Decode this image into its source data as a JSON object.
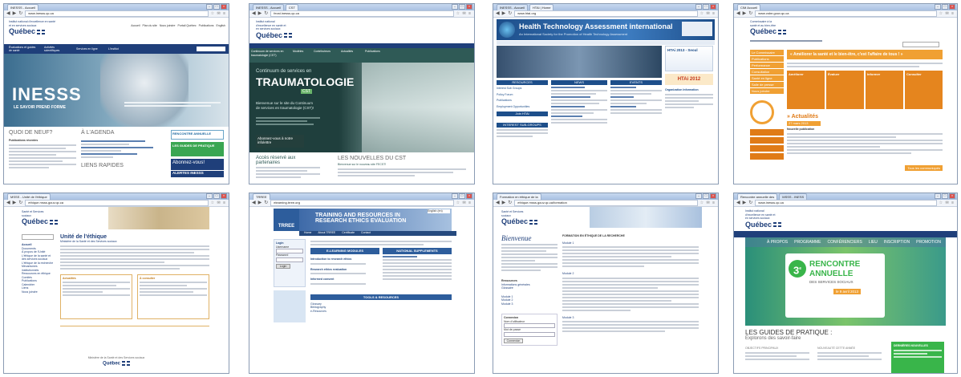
{
  "windows": [
    {
      "tabs": [
        "INESSS - Accueil"
      ],
      "url": "www.inesss.qc.ca",
      "brand": "Institut national d'excellence en santé et en services sociaux",
      "quebec": "Québec",
      "nav": [
        "Accueil",
        "Plan du site",
        "Nous joindre",
        "Portail Québec",
        "Publications",
        "Recherche",
        "English"
      ],
      "menu": [
        "Évaluations et guides de santé",
        "Activités scientifiques",
        "Services en ligne",
        "L'institut"
      ],
      "hero_title": "INESSS",
      "hero_sub": "LE SAVOIR PREND FORME",
      "col1_title": "QUOI DE NEUF?",
      "col2_title": "À L'AGENDA",
      "col1_sub": "Publications récentes",
      "col2_link": "LIENS RAPIDES",
      "promo1": "RENCONTRE ANNUELLE",
      "promo2": "LES GUIDES DE PRATIQUE",
      "promo3": "Abonnez-vous!",
      "promo4": "ALERTES INESSS"
    },
    {
      "tabs": [
        "INESSS - Accueil",
        "CST"
      ],
      "url": "fecst.inesss.qc.ca",
      "quebec": "Québec",
      "hero_small": "Continuum de services en",
      "hero_big": "TRAUMATOLOGIE",
      "hero_badge": "CST",
      "left_menu": [
        "Continuum de services en traumatologie (CST)",
        "Modèles",
        "Contributeurs",
        "Actualités",
        "Publications"
      ],
      "hero_text": "Bienvenue sur le site du Continuum de services en traumatologie (CST)!",
      "cta": "Abonnez-vous à notre infolettre",
      "partner_title": "Accès réservé aux partenaires",
      "news_title": "LES NOUVELLES DU CST",
      "news_sub": "Bienvenue sur le nouveau site FECST!"
    },
    {
      "tabs": [
        "INESSS - Accueil",
        "HTAi | Home"
      ],
      "url": "www.htai.org",
      "title": "Health Technology Assessment international",
      "subtitle": "An International Society for the Promotion of Health Technology Assessment",
      "col_titles": [
        "RESOURCES",
        "NEWS",
        "EVENTS"
      ],
      "links": [
        "Interest Sub Groups",
        "Policy Forum",
        "Publications",
        "Employment Opportunities",
        "Join HTAi"
      ],
      "promo": "HTAi 2013 - Seoul",
      "promo_year": "HTAi 2012",
      "org_title": "Organization Information",
      "interest": "INTEREST SUB-GROUPS"
    },
    {
      "tabs": [
        "CIM Accueil"
      ],
      "url": "www.csbe.gouv.qc.ca",
      "quebec": "Québec",
      "banner": "« Améliorer la santé et le bien-être, c'est l'affaire de tous ! »",
      "left_menu": [
        "Le Commissaire",
        "Publications",
        "Performance",
        "Consultation",
        "Santé en ligne",
        "Salle de presse",
        "Nous joindre"
      ],
      "cols": [
        "Améliorer",
        "Évaluer",
        "Informer",
        "Consulter"
      ],
      "news_title": "» Actualités",
      "news_date": "27 mars 2013",
      "news_item": "Nouvelle publication",
      "footer_link": "Tous les communiqués"
    },
    {
      "tabs": [
        "MSSS - Unité de l'éthique"
      ],
      "url": "ethique.msss.gouv.qc.ca",
      "quebec": "Québec",
      "title": "Unité de l'éthique",
      "subtitle": "Ministère de la Santé et des Services sociaux",
      "menu": [
        "Accueil",
        "Documents",
        "À propos de l'Unité",
        "L'éthique de la santé et des services sociaux",
        "L'éthique de la recherche",
        "Mécanismes institutionnels",
        "Ressources en éthique",
        "Comités",
        "Publications",
        "Calendrier",
        "Liens",
        "Nous joindre"
      ],
      "box1_title": "Actualités",
      "box2_title": "À consulter",
      "footer": "Ministère de la Santé et des Services sociaux",
      "footer_brand": "Québec"
    },
    {
      "tabs": [
        "TRREE"
      ],
      "url": "elearning.trree.org",
      "title": "TRAINING AND RESOURCES IN",
      "title2": "RESEARCH ETHICS EVALUATION",
      "logo": "TRREE",
      "nav": [
        "Home",
        "About TRREE",
        "Certificate",
        "TRREE",
        "Contact"
      ],
      "lang": "English (en)",
      "login_title": "Login",
      "username": "Username",
      "password": "Password",
      "login_btn": "Login",
      "modules_title": "E-LEARNING MODULES",
      "supplements_title": "NATIONAL SUPPLEMENTS",
      "modules": [
        "Introduction to research ethics",
        "Research ethics evaluation",
        "Informed consent"
      ],
      "resources_title": "TOOLS & RESOURCES",
      "resources": [
        "Glossary",
        "Bibliography",
        "e-Resources"
      ]
    },
    {
      "tabs": [
        "Formation en éthique de la"
      ],
      "url": "ethique.msss.gouv.qc.ca/formation",
      "quebec": "Québec",
      "welcome": "Bienvenue",
      "title": "FORMATION EN ÉTHIQUE DE LA RECHERCHE",
      "modules": [
        "Module 1",
        "Module 2",
        "Module 3"
      ],
      "left_title": "Ressources",
      "left_links": [
        "Informations générales",
        "Glossaire"
      ],
      "login_title": "Connexion",
      "login_user": "Nom d'utilisateur",
      "login_pass": "Mot de passe",
      "login_btn": "Connexion"
    },
    {
      "tabs": [
        "Rencontre annuelle des",
        "MSSS - INESS"
      ],
      "url": "www.inesss.qc.ca",
      "quebec": "Québec",
      "nav": [
        "À PROPOS",
        "PROGRAMME",
        "CONFÉRENCIERS",
        "LIEU",
        "INSCRIPTION",
        "PROMOTION"
      ],
      "hero_num": "3",
      "hero_sup": "e",
      "hero_title1": "RENCONTRE",
      "hero_title2": "ANNUELLE",
      "hero_sub": "DES SERVICES SOCIAUX",
      "hero_date": "le 9 avril 2013",
      "guide_title": "LES GUIDES DE PRATIQUE :",
      "guide_sub": "Explorons des savoir-faire",
      "cols": [
        "OBJECTIFS PRINCIPAUX",
        "NOUVEAUTÉ CETTE ANNÉE"
      ],
      "news_title": "DERNIÈRES NOUVELLES"
    }
  ],
  "colors": {
    "quebec_blue": "#1f3f7a",
    "inesss_teal": "#2a8fb0",
    "cst_green": "#2f5a56",
    "htai_blue": "#1d4e8a",
    "csbe_orange": "#f0a033",
    "rencontre_green": "#39b54a"
  }
}
